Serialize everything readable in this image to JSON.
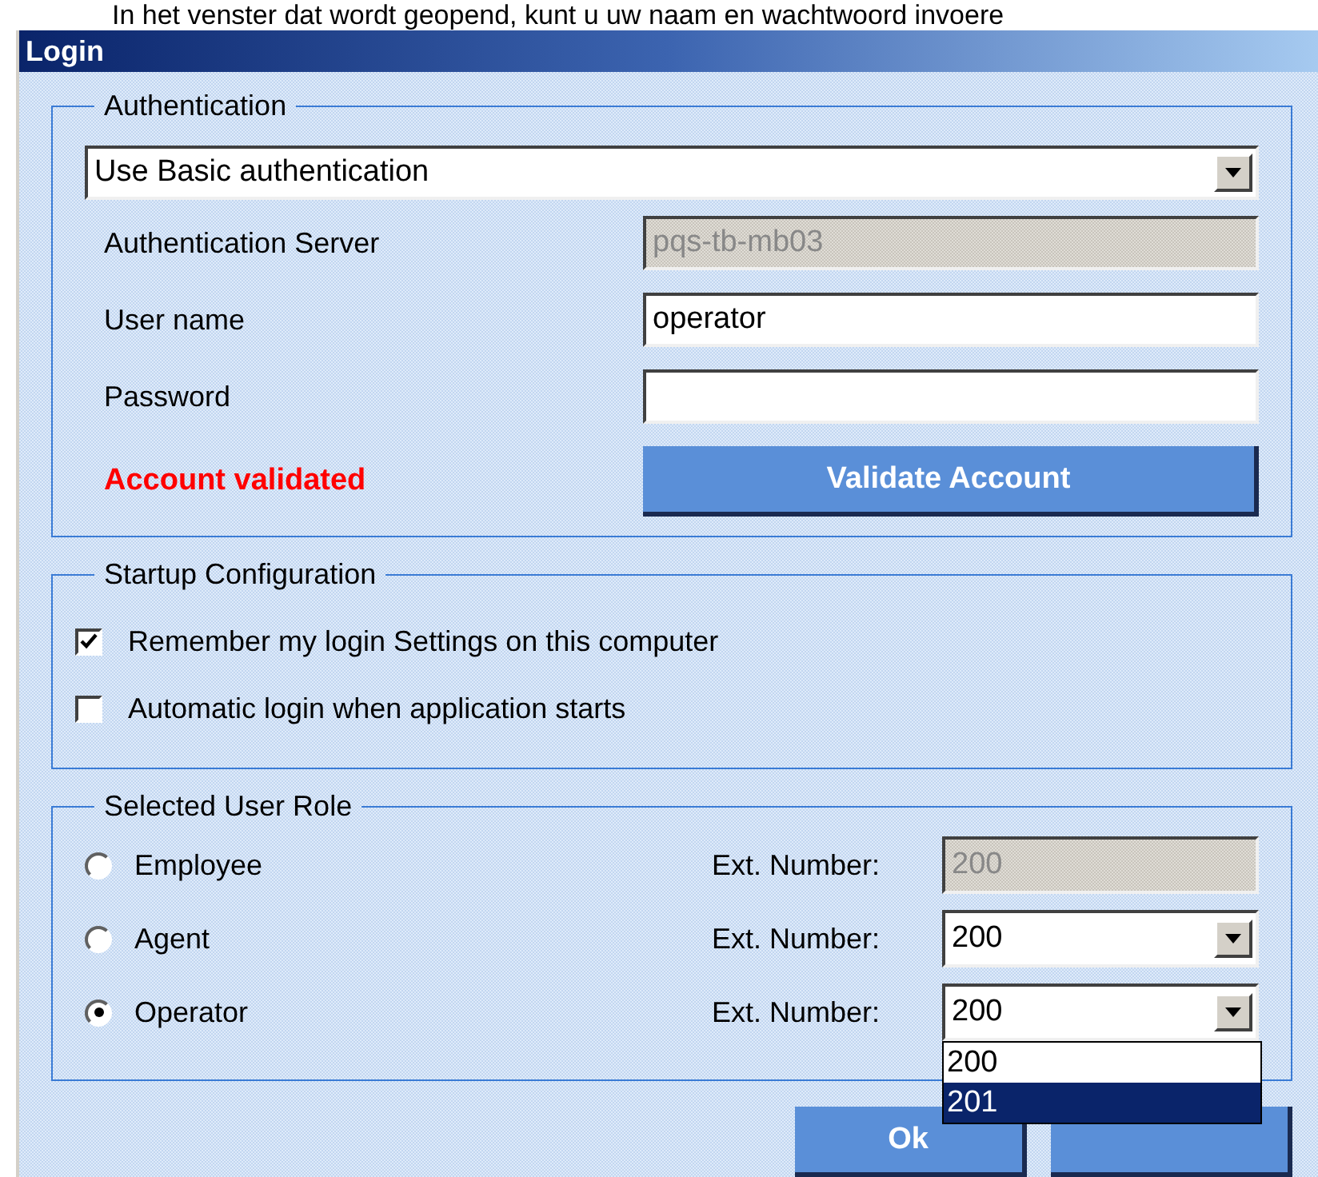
{
  "caption": "In het venster dat wordt geopend, kunt u uw naam en wachtwoord invoere",
  "window": {
    "title": "Login"
  },
  "authentication": {
    "legend": "Authentication",
    "method": "Use Basic authentication",
    "fields": [
      {
        "label": "Authentication Server",
        "value": "pqs-tb-mb03",
        "disabled": true
      },
      {
        "label": "User name",
        "value": "operator",
        "disabled": false
      },
      {
        "label": "Password",
        "disabled": false
      }
    ],
    "status": "Account validated",
    "validate_button": "Validate Account"
  },
  "startup": {
    "legend": "Startup Configuration",
    "options": [
      {
        "label": "Remember my login Settings on this computer",
        "checked": true
      },
      {
        "label": "Automatic login when application starts",
        "checked": false
      }
    ]
  },
  "user_role": {
    "legend": "Selected User Role",
    "roles": [
      {
        "label": "Employee",
        "selected": false,
        "ext_label": "Ext. Number:",
        "ext_value": "200",
        "kind": "text",
        "disabled": true
      },
      {
        "label": "Agent",
        "selected": false,
        "ext_label": "Ext. Number:",
        "ext_value": "200",
        "kind": "dropdown"
      },
      {
        "label": "Operator",
        "selected": true,
        "ext_label": "Ext. Number:",
        "ext_value": "200",
        "kind": "dropdown",
        "expanded": true,
        "options": [
          {
            "label": "200",
            "selected": false
          },
          {
            "label": "201",
            "selected": true
          }
        ]
      }
    ]
  },
  "buttons": [
    {
      "kind": "text",
      "label": "Ok"
    },
    {
      "kind": "covered"
    }
  ]
}
